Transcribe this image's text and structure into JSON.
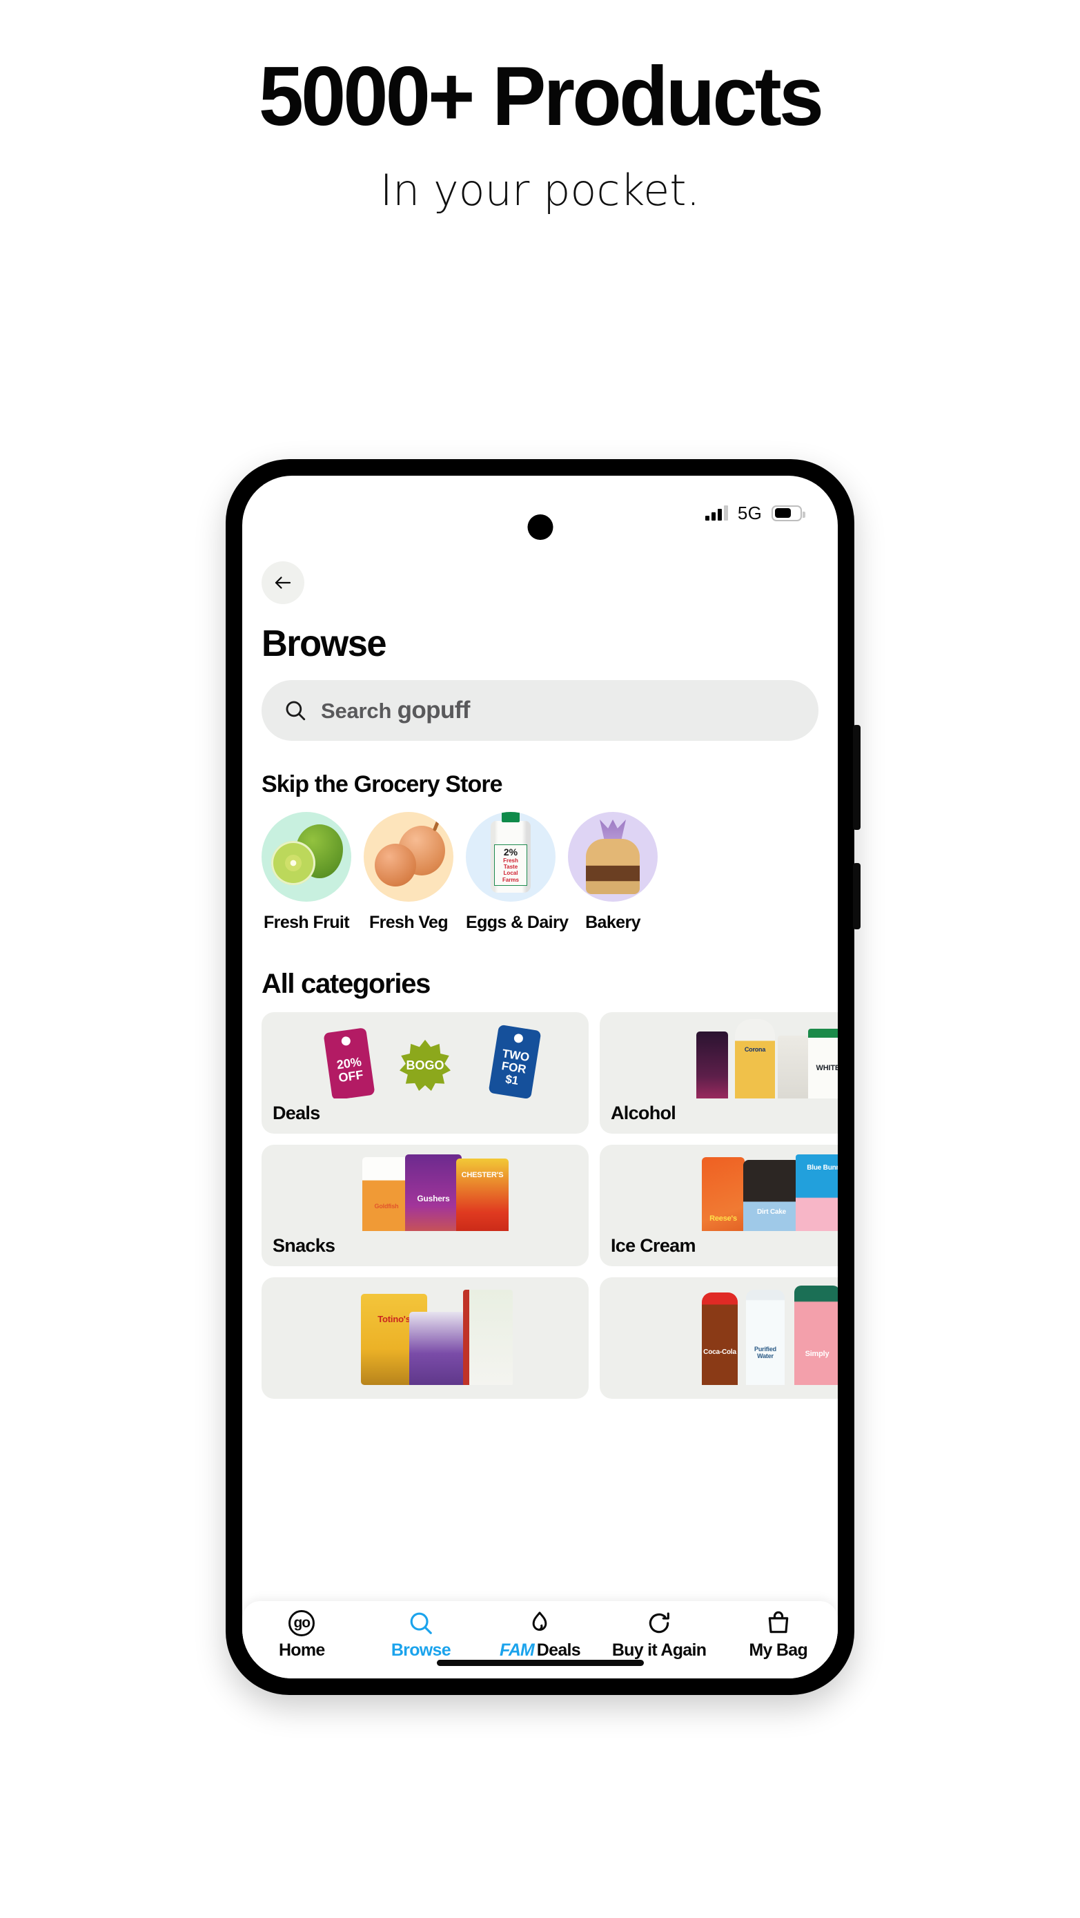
{
  "hero": {
    "title": "5000+ Products",
    "subtitle": "In your pocket."
  },
  "phone": {
    "status_bar": {
      "network": "5G",
      "signal_icon": "signal-bars-icon",
      "battery_icon": "battery-icon"
    },
    "home_indicator": "home-indicator"
  },
  "app": {
    "back_icon": "arrow-left-icon",
    "page_title": "Browse",
    "search": {
      "icon": "search-icon",
      "placeholder_prefix": "Search ",
      "brand": "gopuff"
    },
    "skip_section": {
      "title": "Skip the Grocery Store",
      "items": [
        {
          "label": "Fresh Fruit",
          "bg": "#c8f0df"
        },
        {
          "label": "Fresh Veg",
          "bg": "#fde4bb"
        },
        {
          "label": "Eggs & Dairy",
          "bg": "#dfeefb"
        },
        {
          "label": "Bakery",
          "bg": "#ded4f4"
        }
      ]
    },
    "all_categories": {
      "title": "All categories",
      "cards": [
        {
          "label": "Deals",
          "art": "deals-tags"
        },
        {
          "label": "Alcohol",
          "art": "alcohol-bottles"
        },
        {
          "label": "Snacks",
          "art": "snack-bags"
        },
        {
          "label": "Ice Cream",
          "art": "ice-cream-packs"
        },
        {
          "label": "",
          "art": "frozen-foods"
        },
        {
          "label": "",
          "art": "drinks"
        }
      ]
    },
    "deals_art": {
      "tag1_line1": "20%",
      "tag1_line2": "OFF",
      "tag2": "BOGO",
      "tag3_line1": "TWO",
      "tag3_line2": "FOR",
      "tag3_line3": "$1"
    },
    "bottom_nav": {
      "items": [
        {
          "label": "Home",
          "icon": "go-logo-icon",
          "active": false,
          "prefix": ""
        },
        {
          "label": "Browse",
          "icon": "search-icon",
          "active": true,
          "prefix": ""
        },
        {
          "label": "Deals",
          "icon": "flame-icon",
          "active": false,
          "prefix": "FAM"
        },
        {
          "label": "Buy it Again",
          "icon": "refresh-icon",
          "active": false,
          "prefix": ""
        },
        {
          "label": "My Bag",
          "icon": "shopping-bag-icon",
          "active": false,
          "prefix": ""
        }
      ]
    }
  },
  "colors": {
    "accent_blue": "#1ba3ec",
    "card_bg": "#eeefec",
    "search_bg": "#ebeceb",
    "text": "#080808"
  }
}
